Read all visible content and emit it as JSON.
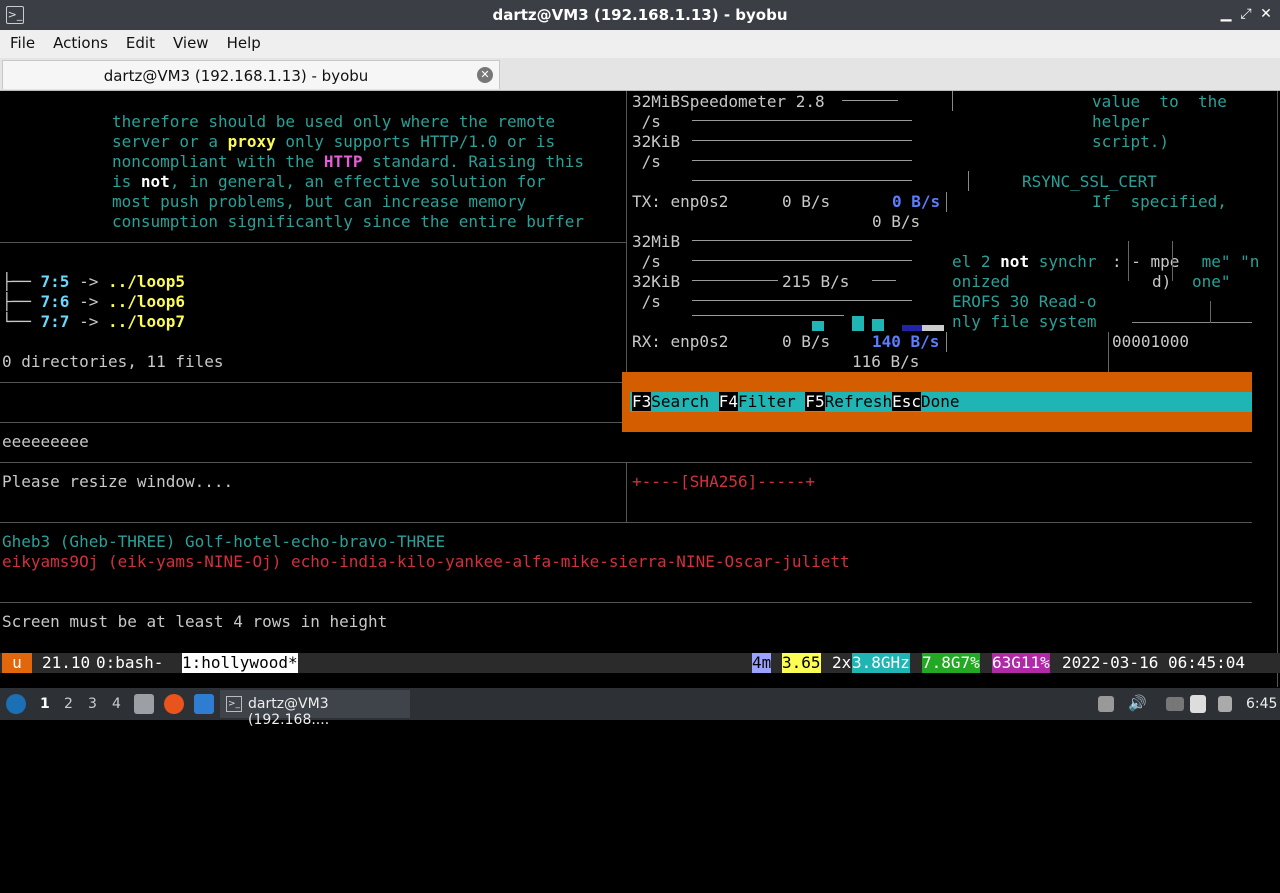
{
  "window": {
    "title": "dartz@VM3 (192.168.1.13) - byobu",
    "app_icon": "terminal-icon"
  },
  "menu": [
    "File",
    "Actions",
    "Edit",
    "View",
    "Help"
  ],
  "tab": {
    "label": "dartz@VM3 (192.168.1.13) - byobu"
  },
  "pane_man": {
    "l1": "therefore should be used only where the remote",
    "l2a": "server or a ",
    "l2b": "proxy",
    "l2c": " only supports HTTP/1.0 or is",
    "l3a": "noncompliant with the ",
    "l3b": "HTTP",
    "l3c": " standard. Raising this",
    "l4a": "is ",
    "l4b": "not",
    "l4c": ", in general, an effective solution for",
    "l5": "most push problems, but can increase memory",
    "l6": "consumption significantly since the entire buffer"
  },
  "pane_tree": {
    "rows": [
      {
        "branch": "├── ",
        "num": "7:5",
        "arrow": " -> ",
        "target": "../loop5"
      },
      {
        "branch": "├── ",
        "num": "7:6",
        "arrow": " -> ",
        "target": "../loop6"
      },
      {
        "branch": "└── ",
        "num": "7:7",
        "arrow": " -> ",
        "target": "../loop7"
      }
    ],
    "summary": "0 directories, 11 files"
  },
  "pane_e": "eeeeeeeee",
  "pane_resize": "Please resize window....",
  "pane_names": {
    "green": "Gheb3 (Gheb-THREE) Golf-hotel-echo-bravo-THREE",
    "red": "eikyams9Oj (eik-yams-NINE-Oj) echo-india-kilo-yankee-alfa-mike-sierra-NINE-Oscar-juliett"
  },
  "pane_rows": "Screen must be at least 4 rows in height",
  "speedometer": {
    "title": "Speedometer 2.8",
    "tx_label": "TX: enp0s2",
    "tx_v1": "0 B/s",
    "tx_v2": "0 B/s",
    "tx_v3": "0 B/s",
    "rx_label": "RX: enp0s2",
    "rx_v1": "0 B/s",
    "rx_v2": "140 B/s",
    "rx_v3": "116 B/s",
    "scale_32mib": "32MiB",
    "scale_32kib": "32KiB",
    "per_s": " /s",
    "mid_rate": "215 B/s"
  },
  "rsync": {
    "l1": "value  to  the",
    "l2": "helper",
    "l3": "script.)",
    "l4": "RSYNC_SSL_CERT",
    "l5": "If  specified,"
  },
  "garble": {
    "g1a": "el 2 ",
    "g1b": "not",
    "g1c": " synchr",
    "g1d": ": - mpe",
    "g1e": " me\" \"n",
    "g2a": "onized",
    "g2b": "d)",
    "g2c": "one\"",
    "g3": "EROFS 30 Read-o",
    "g4": "nly file system",
    "hex": "00001000"
  },
  "htop_footer": [
    {
      "key": "F3",
      "label": "Search"
    },
    {
      "key": "F4",
      "label": "Filter"
    },
    {
      "key": "F5",
      "label": "Refresh"
    },
    {
      "key": "Esc",
      "label": "Done"
    }
  ],
  "sha_box": "+----[SHA256]-----+",
  "status": {
    "u": "u",
    "release": "21.10",
    "win0": "0:bash-",
    "win1": "1:hollywood*",
    "uptime": "4m",
    "load": "3.65",
    "cpu_count": "2x",
    "freq": "3.8GHz",
    "mem": "7.8G",
    "mem_pct": "7%",
    "disk": "63G",
    "disk_pct": "11%",
    "datetime": "2022-03-16 06:45:04"
  },
  "taskbar": {
    "workspaces": [
      "1",
      "2",
      "3",
      "4"
    ],
    "task": "dartz@VM3 (192.168....",
    "clock": "6:45"
  },
  "colors": {
    "accent_orange": "#d45d00",
    "cyan": "#2aa198",
    "status_bg": "#2b2b2b"
  }
}
